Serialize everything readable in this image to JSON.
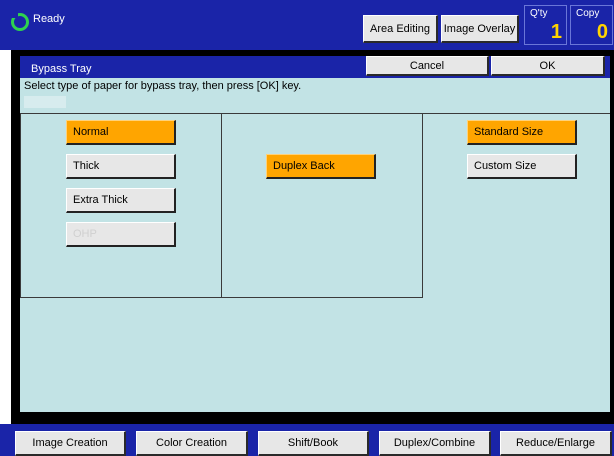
{
  "status": {
    "ready_text": "Ready"
  },
  "header": {
    "area_editing": "Area Editing",
    "image_overlay": "Image Overlay",
    "qty_label": "Q'ty",
    "qty_value": "1",
    "copy_label": "Copy",
    "copy_value": "0"
  },
  "dialog": {
    "title": "Bypass Tray",
    "cancel": "Cancel",
    "ok": "OK",
    "instruction": "Select type of paper for bypass tray, then press [OK] key."
  },
  "paper_types": {
    "normal": "Normal",
    "thick": "Thick",
    "extra_thick": "Extra Thick",
    "ohp": "OHP"
  },
  "duplex": {
    "label": "Duplex Back"
  },
  "size": {
    "standard": "Standard Size",
    "custom": "Custom Size"
  },
  "tabs": [
    "Image Creation",
    "Color Creation",
    "Shift/Book",
    "Duplex/Combine",
    "Reduce/Enlarge"
  ],
  "colors": {
    "header_blue": "#1a24a8",
    "selected_orange": "#ffa500",
    "panel_cyan": "#c2e3e5",
    "ready_green": "#2fd14f",
    "counter_yellow": "#ffd400"
  }
}
